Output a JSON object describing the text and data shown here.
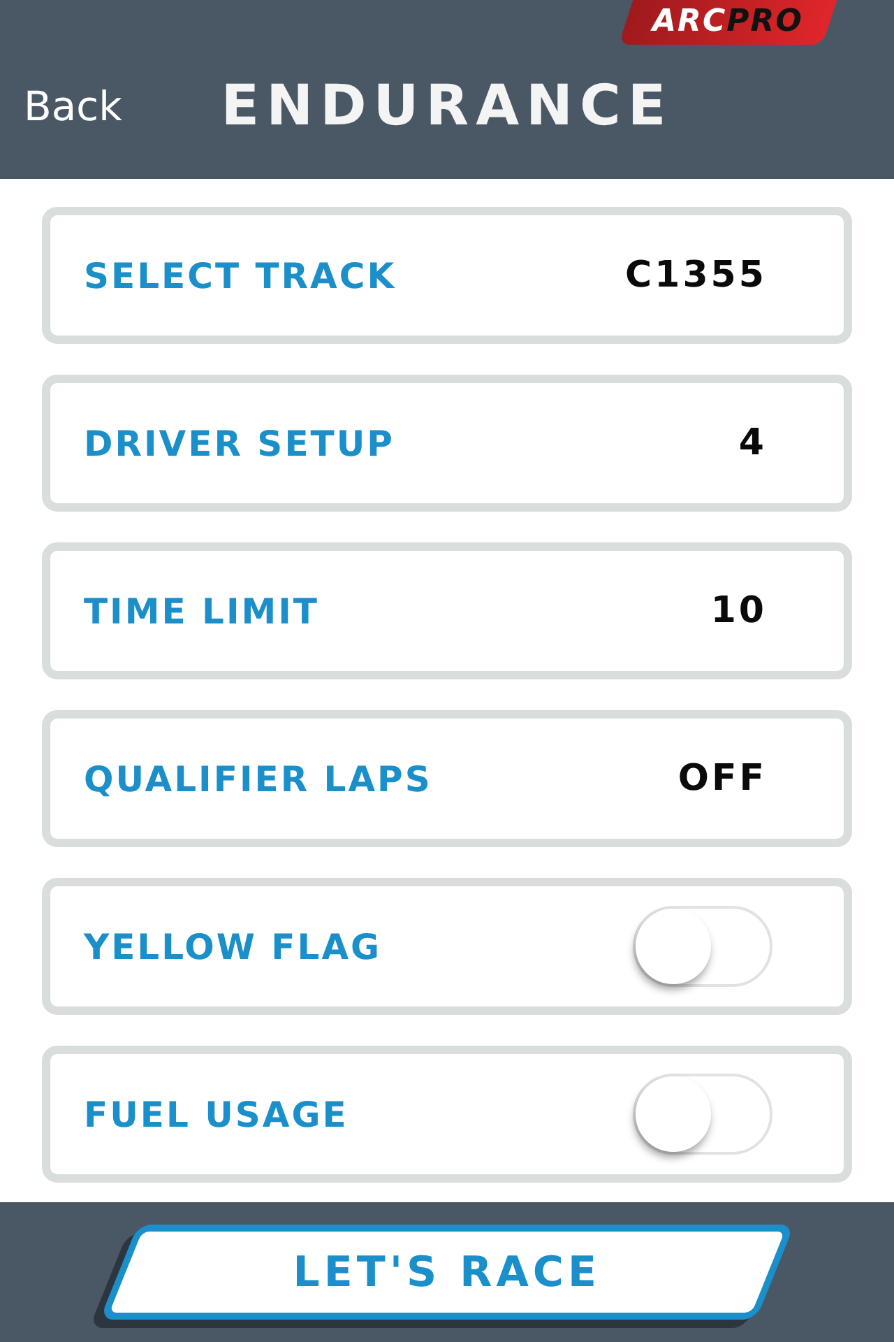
{
  "logo": {
    "text": "ARC",
    "accent": "PRO"
  },
  "header": {
    "back": "Back",
    "title": "ENDURANCE"
  },
  "rows": [
    {
      "kind": "value",
      "label": "SELECT TRACK",
      "value": "C1355"
    },
    {
      "kind": "value",
      "label": "DRIVER SETUP",
      "value": "4"
    },
    {
      "kind": "value",
      "label": "TIME LIMIT",
      "value": "10"
    },
    {
      "kind": "value",
      "label": "QUALIFIER LAPS",
      "value": "OFF"
    },
    {
      "kind": "toggle",
      "label": "YELLOW FLAG",
      "on": false
    },
    {
      "kind": "toggle",
      "label": "FUEL USAGE",
      "on": false
    }
  ],
  "action": {
    "label": "LET'S RACE"
  }
}
